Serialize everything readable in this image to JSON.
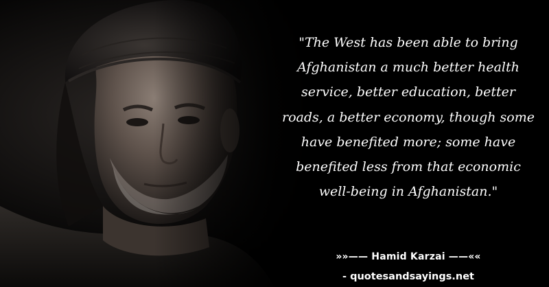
{
  "quote": {
    "lines": [
      "\"The West has been able to bring",
      "Afghanistan a much better health",
      "service, better education, better",
      "roads, a better economy, though some",
      "have benefited more; some have",
      "benefited less from that economic",
      "well-being in Afghanistan.\""
    ]
  },
  "author": "»»—— Hamid Karzai ——««",
  "source": "- quotesandsayings.net",
  "colors": {
    "background": "#000000",
    "text": "#ffffff"
  }
}
